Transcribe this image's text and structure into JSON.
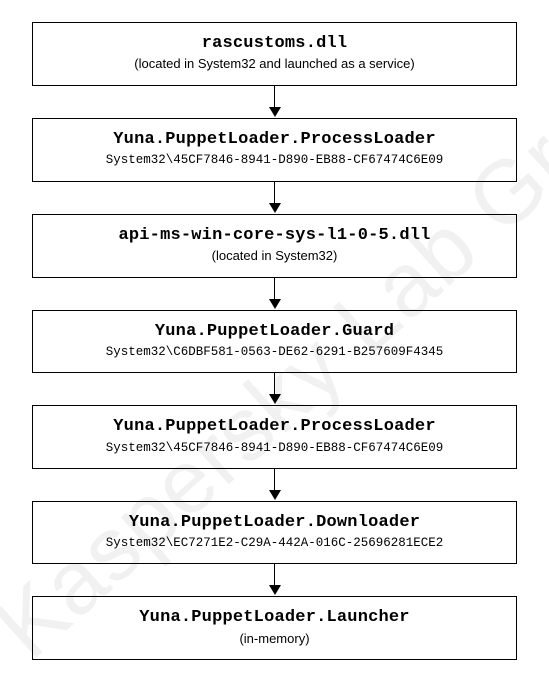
{
  "watermark": "Kaspersky Lab Great",
  "nodes": [
    {
      "title": "rascustoms.dll",
      "sub": "(located in System32 and launched as a service)",
      "subMono": false
    },
    {
      "title": "Yuna.PuppetLoader.ProcessLoader",
      "sub": "System32\\45CF7846-8941-D890-EB88-CF67474C6E09",
      "subMono": true
    },
    {
      "title": "api-ms-win-core-sys-l1-0-5.dll",
      "sub": "(located in System32)",
      "subMono": false
    },
    {
      "title": "Yuna.PuppetLoader.Guard",
      "sub": "System32\\C6DBF581-0563-DE62-6291-B257609F4345",
      "subMono": true
    },
    {
      "title": "Yuna.PuppetLoader.ProcessLoader",
      "sub": "System32\\45CF7846-8941-D890-EB88-CF67474C6E09",
      "subMono": true
    },
    {
      "title": "Yuna.PuppetLoader.Downloader",
      "sub": "System32\\EC7271E2-C29A-442A-016C-25696281ECE2",
      "subMono": true
    },
    {
      "title": "Yuna.PuppetLoader.Launcher",
      "sub": "(in-memory)",
      "subMono": false
    }
  ]
}
